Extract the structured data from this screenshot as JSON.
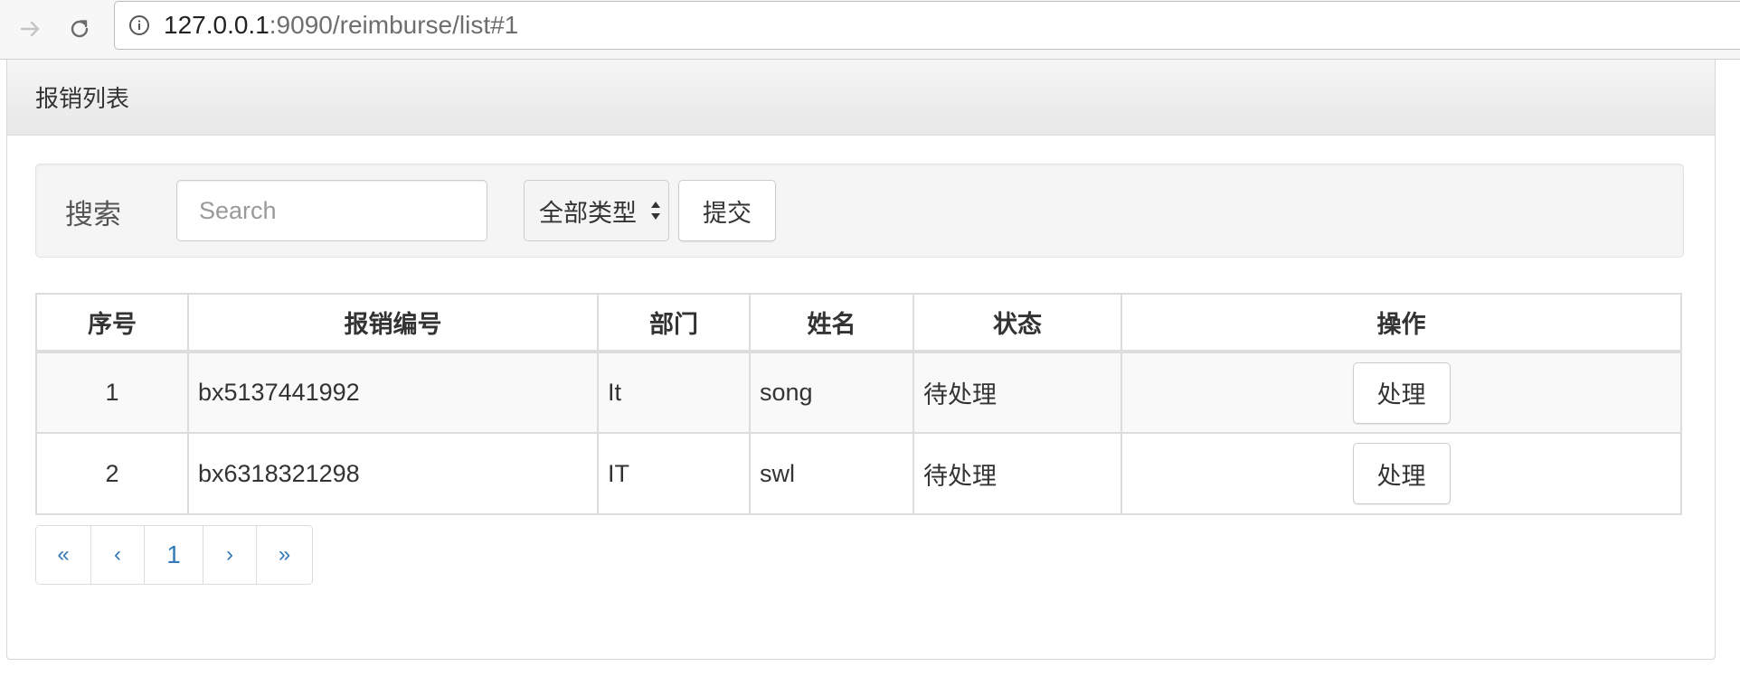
{
  "browser": {
    "url_host": "127.0.0.1",
    "url_rest": ":9090/reimburse/list#1",
    "icons": {
      "forward": "forward-arrow-icon",
      "reload": "reload-icon",
      "info": "info-icon"
    }
  },
  "panel": {
    "title": "报销列表"
  },
  "search": {
    "label": "搜索",
    "placeholder": "Search",
    "value": "",
    "type_select_value": "全部类型",
    "submit_label": "提交"
  },
  "table": {
    "headers": [
      "序号",
      "报销编号",
      "部门",
      "姓名",
      "状态",
      "操作"
    ],
    "rows": [
      {
        "index": "1",
        "code": "bx5137441992",
        "department": "It",
        "name": "song",
        "status": "待处理",
        "action": "处理"
      },
      {
        "index": "2",
        "code": "bx6318321298",
        "department": "IT",
        "name": "swl",
        "status": "待处理",
        "action": "处理"
      }
    ]
  },
  "pagination": {
    "first": "«",
    "prev": "‹",
    "current": "1",
    "next": "›",
    "last": "»"
  },
  "colors": {
    "link": "#337ab7",
    "border": "#dddddd",
    "well_bg": "#f5f5f5"
  }
}
